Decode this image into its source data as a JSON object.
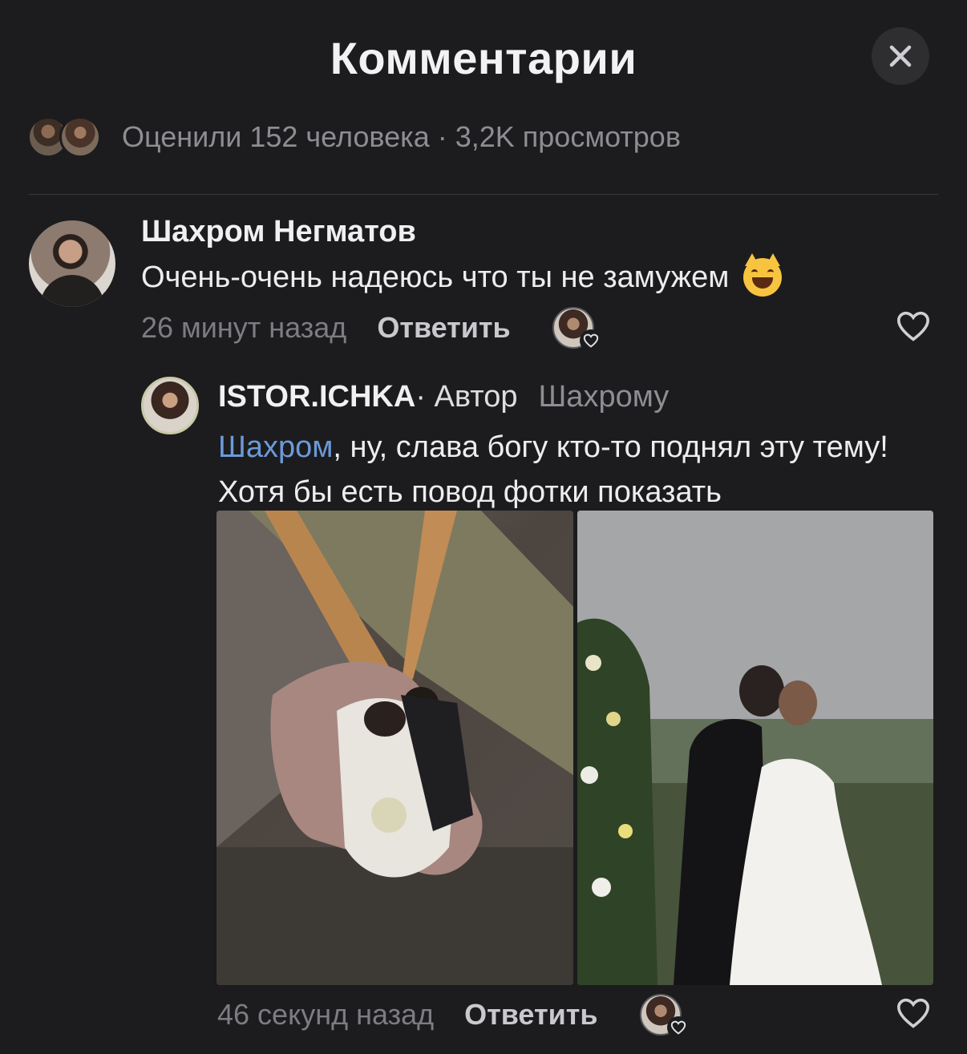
{
  "header": {
    "title": "Комментарии",
    "close_icon": "close-icon"
  },
  "stats": {
    "text": "Оценили 152 человека · 3,2K просмотров"
  },
  "comments": [
    {
      "author": "Шахром Негматов",
      "text": "Очень-очень надеюсь что ты не замужем",
      "emoji": "smiling-cat-emoji",
      "time": "26 минут назад",
      "reply_label": "Ответить"
    },
    {
      "author": "ISTOR.ICHKA",
      "role": " · Автор",
      "reply_to": "Шахрому",
      "mention": "Шахром",
      "text": ", ну, слава богу кто-то поднял эту тему! Хотя бы есть повод фотки показать",
      "photos": [
        "wedding-photo-sofa",
        "wedding-photo-kiss"
      ],
      "time": "46 секунд назад",
      "reply_label": "Ответить"
    }
  ],
  "colors": {
    "background": "#1c1c1e",
    "mention": "#6c9ad8",
    "muted": "#7c7c82"
  }
}
